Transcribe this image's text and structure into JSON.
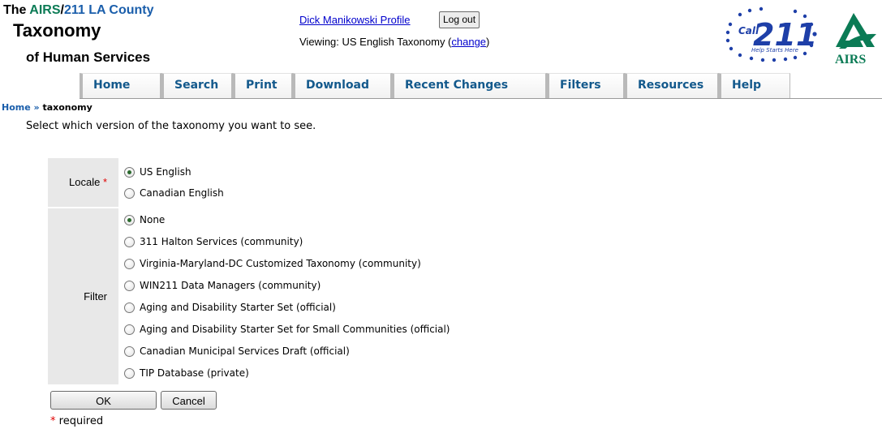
{
  "brand": {
    "the": "The ",
    "airs": "AIRS",
    "slash": "/",
    "la": "211 LA County",
    "taxonomy": "Taxonomy",
    "subtitle": "of Human Services"
  },
  "profile": {
    "link": "Dick Manikowski Profile",
    "logout": "Log out",
    "viewing_prefix": "Viewing: US English Taxonomy (",
    "change": "change",
    "viewing_suffix": ")"
  },
  "logos": {
    "call211_call": "Call",
    "call211_number": "211",
    "call211_tagline": "Help Starts Here",
    "airs": "AIRS"
  },
  "nav": {
    "tabs": [
      "Home",
      "Search",
      "Print",
      "Download",
      "Recent Changes",
      "Filters",
      "Resources",
      "Help"
    ]
  },
  "breadcrumb": {
    "home": "Home",
    "sep": " » ",
    "current": "taxonomy"
  },
  "instruction": "Select which version of the taxonomy you want to see.",
  "form": {
    "locale_label": "Locale",
    "required_marker": "*",
    "locale_options": [
      {
        "label": "US English",
        "checked": true
      },
      {
        "label": "Canadian English",
        "checked": false
      }
    ],
    "filter_label": "Filter",
    "filter_options": [
      {
        "label": "None",
        "checked": true
      },
      {
        "label": "311 Halton Services (community)",
        "checked": false
      },
      {
        "label": "Virginia-Maryland-DC Customized Taxonomy (community)",
        "checked": false
      },
      {
        "label": "WIN211 Data Managers (community)",
        "checked": false
      },
      {
        "label": "Aging and Disability Starter Set (official)",
        "checked": false
      },
      {
        "label": "Aging and Disability Starter Set for Small Communities (official)",
        "checked": false
      },
      {
        "label": "Canadian Municipal Services Draft (official)",
        "checked": false
      },
      {
        "label": "TIP Database (private)",
        "checked": false
      }
    ],
    "ok": "OK",
    "cancel": "Cancel",
    "required_note": "required"
  },
  "colors": {
    "link": "#0000cc",
    "nav_text": "#13598c",
    "airs_green": "#0b7b55",
    "brand_blue": "#1a5eab",
    "required": "#e00000",
    "label_bg": "#e8e8e8"
  }
}
